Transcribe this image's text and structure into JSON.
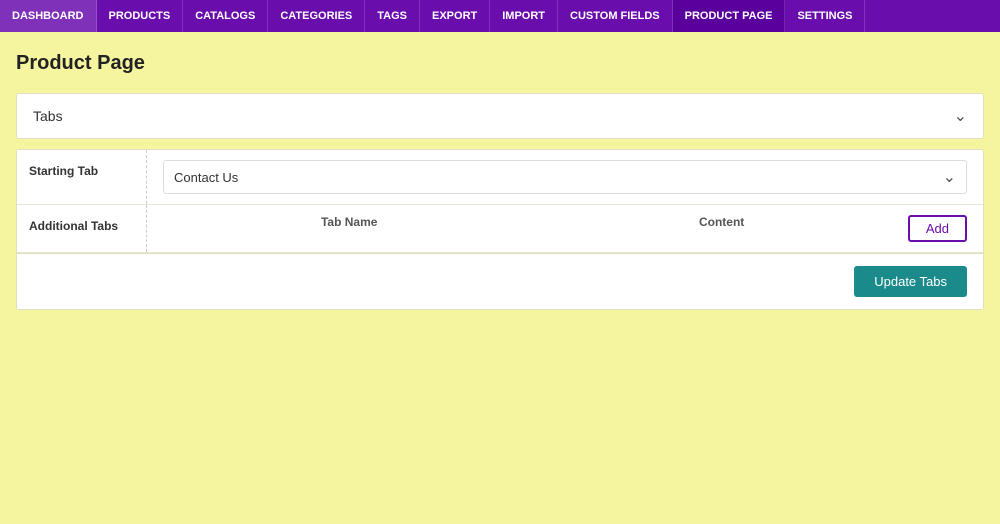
{
  "nav": {
    "items": [
      {
        "id": "dashboard",
        "label": "DASHBOARD",
        "active": false
      },
      {
        "id": "products",
        "label": "PRODUCTS",
        "active": false
      },
      {
        "id": "catalogs",
        "label": "CATALOGS",
        "active": false
      },
      {
        "id": "categories",
        "label": "CATEGORIES",
        "active": false
      },
      {
        "id": "tags",
        "label": "TAGS",
        "active": false
      },
      {
        "id": "export",
        "label": "EXPORT",
        "active": false
      },
      {
        "id": "import",
        "label": "IMPORT",
        "active": false
      },
      {
        "id": "custom-fields",
        "label": "CUSTOM FIELDS",
        "active": false
      },
      {
        "id": "product-page",
        "label": "PRODUCT PAGE",
        "active": true
      },
      {
        "id": "settings",
        "label": "SETTINGS",
        "active": false
      }
    ]
  },
  "page": {
    "title": "Product Page"
  },
  "tabs_section": {
    "header": "Tabs"
  },
  "starting_tab": {
    "label": "Starting Tab",
    "value": "Contact Us"
  },
  "additional_tabs": {
    "label": "Additional Tabs",
    "col_tab_name": "Tab Name",
    "col_content": "Content",
    "add_button_label": "Add"
  },
  "footer": {
    "update_button_label": "Update Tabs"
  }
}
